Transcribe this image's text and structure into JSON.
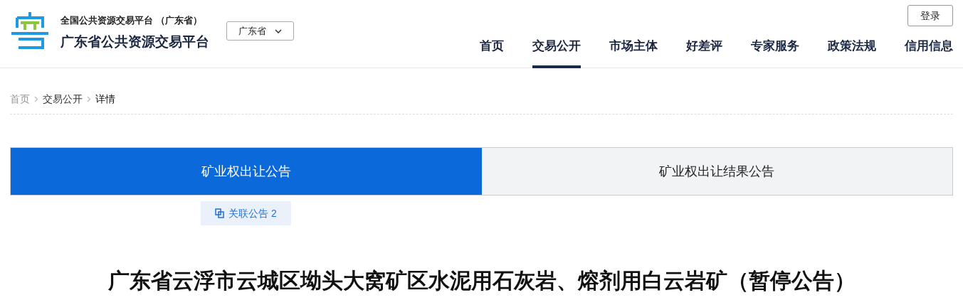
{
  "header": {
    "subtitle": "全国公共资源交易平台 （广东省）",
    "title": "广东省公共资源交易平台",
    "region_select": "广东省",
    "login": "登录"
  },
  "nav": [
    {
      "label": "首页",
      "selected": false
    },
    {
      "label": "交易公开",
      "selected": true
    },
    {
      "label": "市场主体",
      "selected": false
    },
    {
      "label": "好差评",
      "selected": false
    },
    {
      "label": "专家服务",
      "selected": false
    },
    {
      "label": "政策法规",
      "selected": false
    },
    {
      "label": "信用信息",
      "selected": false
    }
  ],
  "breadcrumb": [
    "首页",
    "交易公开",
    "详情"
  ],
  "tabs": [
    {
      "label": "矿业权出让公告",
      "selected": true
    },
    {
      "label": "矿业权出让结果公告",
      "selected": false
    }
  ],
  "related": {
    "label": "关联公告 2"
  },
  "heading": "广东省云浮市云城区坳头大窝矿区水泥用石灰岩、熔剂用白云岩矿（暂停公告）"
}
